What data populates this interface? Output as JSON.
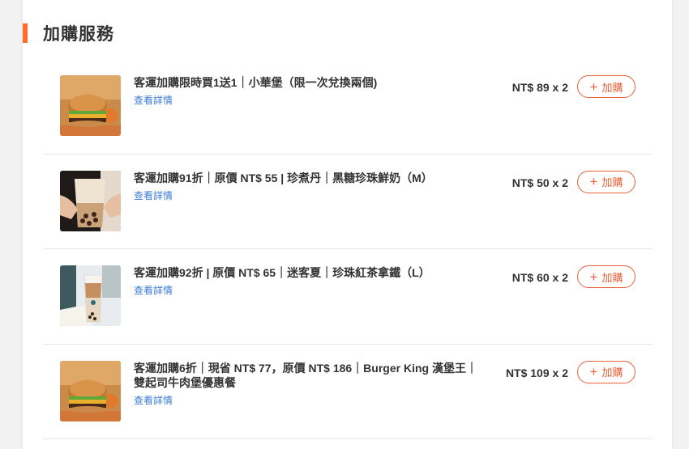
{
  "section": {
    "title": "加購服務"
  },
  "items": [
    {
      "name": "客運加購限時買1送1｜小華堡（限一次兌換兩個)",
      "detail": "查看詳情",
      "price": "NT$ 89 x 2",
      "button": "加購",
      "image": "burger-combo"
    },
    {
      "name": "客運加購91折｜原價 NT$ 55 | 珍煮丹｜黑糖珍珠鮮奶（M）",
      "detail": "查看詳情",
      "price": "NT$ 50 x 2",
      "button": "加購",
      "image": "bubble-milk-tea"
    },
    {
      "name": "客運加購92折 | 原價 NT$ 65｜迷客夏｜珍珠紅茶拿鐵（L）",
      "detail": "查看詳情",
      "price": "NT$ 60 x 2",
      "button": "加購",
      "image": "black-tea-latte"
    },
    {
      "name": "客運加購6折｜現省 NT$ 77，原價 NT$ 186｜Burger King 漢堡王｜雙起司牛肉堡優惠餐",
      "detail": "查看詳情",
      "price": "NT$ 109 x 2",
      "button": "加購",
      "image": "burger-combo"
    }
  ],
  "colors": {
    "accent": "#ff6d2e",
    "button": "#e8613a",
    "link": "#3a7bd5"
  }
}
